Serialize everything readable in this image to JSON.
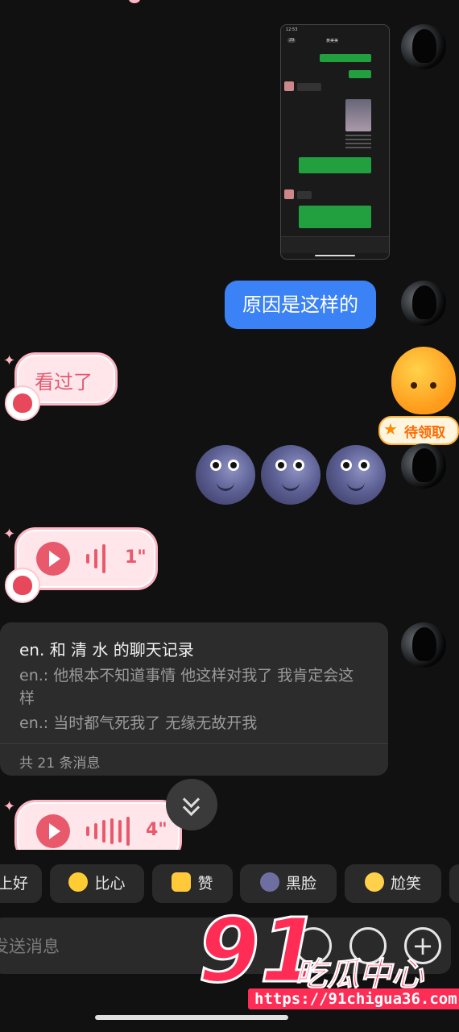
{
  "messages": {
    "text_reason": "原因是这样的",
    "sticker_seen": "看过了",
    "voice1_duration": "1\"",
    "voice2_duration": "4\""
  },
  "screenshot_preview": {
    "status_time": "12:53",
    "back_badge": "29",
    "title": "黄美美"
  },
  "chat_record_card": {
    "title": "en. 和 清 水 的聊天记录",
    "line1": "en.: 他根本不知道事情 他这样对我了 我肯定会这样",
    "line2": "en.: 当时都气死我了 无缘无故开我",
    "footer": "共 21 条消息"
  },
  "reward_badge": "待领取",
  "quick_replies": [
    {
      "label": "上好",
      "icon": ""
    },
    {
      "label": "比心",
      "icon": "hand-heart-emoji"
    },
    {
      "label": "赞",
      "icon": "thumbs-up-emoji"
    },
    {
      "label": "黑脸",
      "icon": "new-moon-face-emoji"
    },
    {
      "label": "尬笑",
      "icon": "grin-sweat-emoji"
    }
  ],
  "input": {
    "placeholder": "发送消息"
  },
  "watermark": {
    "logo_num": "91",
    "logo_text": "吃瓜中心",
    "url": "https://91chigua36.com"
  },
  "colors": {
    "background": "#111111",
    "blue_bubble": "#3b82f6",
    "pink_bubble": "#ffe6ea",
    "accent_red": "#e85a6b",
    "watermark": "#ff2d55"
  }
}
